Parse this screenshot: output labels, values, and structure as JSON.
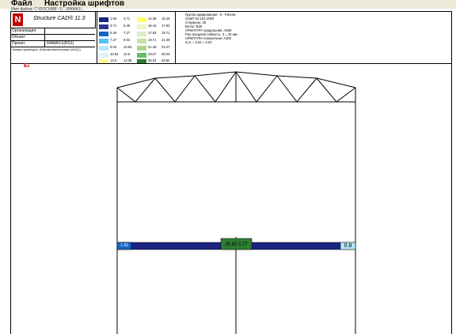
{
  "menu": {
    "items": [
      {
        "label": "Файл"
      },
      {
        "label": "Настройка шрифтов"
      }
    ]
  },
  "path_text": "Имя файла: C:\\DOCUME~1\\...\\RAMA1\\...",
  "logo": {
    "text": "Structure CAD® 11.3"
  },
  "info_rows": [
    {
      "label": "Организация",
      "value": ""
    },
    {
      "label": "Объект",
      "value": ""
    },
    {
      "label": "Проект",
      "value": "RAMA1\\1(RS1)"
    }
  ],
  "info_note": "Эпюры арматуры, АЗ(нижняя)/нитраж(+)/АЗ(1)",
  "legend": [
    {
      "color": "#1a237e",
      "a": "1.93",
      "b": "3.71"
    },
    {
      "color": "#283593",
      "a": "3.71",
      "b": "5.49"
    },
    {
      "color": "#1565c0",
      "a": "5.49",
      "b": "7.27"
    },
    {
      "color": "#4fc3f7",
      "a": "7.27",
      "b": "9.04"
    },
    {
      "color": "#b3e5fc",
      "a": "9.04",
      "b": "10.82"
    },
    {
      "color": "#e0f2f1",
      "a": "10.82",
      "b": "12.6"
    },
    {
      "color": "#fff59d",
      "a": "12.6",
      "b": "14.38"
    },
    {
      "color": "#ffff66",
      "a": "14.38",
      "b": "16.16"
    },
    {
      "color": "#f0f4c3",
      "a": "16.16",
      "b": "17.93"
    },
    {
      "color": "#dcedc8",
      "a": "17.93",
      "b": "19.71"
    },
    {
      "color": "#c5e1a5",
      "a": "19.71",
      "b": "21.49"
    },
    {
      "color": "#aed581",
      "a": "21.49",
      "b": "23.27"
    },
    {
      "color": "#66bb6a",
      "a": "23.27",
      "b": "26.04"
    },
    {
      "color": "#2e7d32",
      "a": "26.04",
      "b": "26.82"
    }
  ],
  "notes": [
    "Группа армирования : 5 - Ригели",
    "СНиП 52-101-2003",
    "Стержень: 25",
    "Бетон: В25",
    "АРМАТУРА продольная: А500",
    "Раз-трещиностойкость: З = 32 мм",
    "АРМАТУРА поперечная: А300",
    "S,r1 = 4,02 = 4,02"
  ],
  "beam": {
    "left_label": "1.93",
    "center_label": "26.82 0.77",
    "right_label": "0.8"
  }
}
